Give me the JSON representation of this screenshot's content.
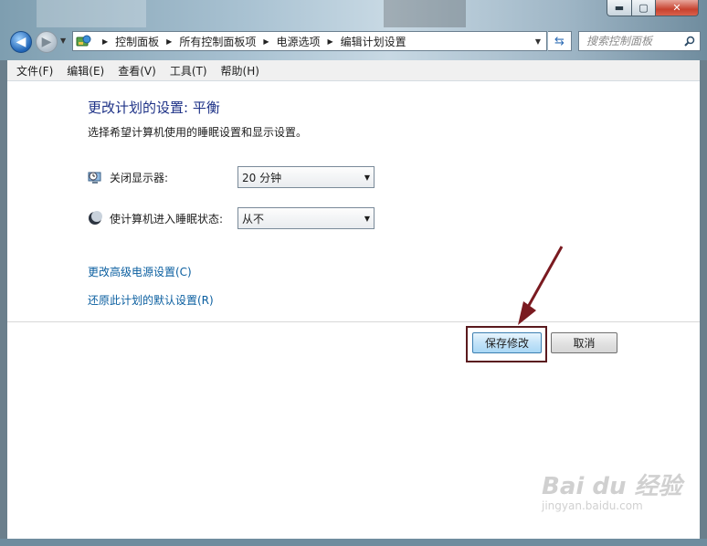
{
  "window": {
    "buttons": {
      "minimize": "▬",
      "maximize": "▢",
      "close": "✕"
    }
  },
  "nav": {
    "back_icon": "arrow-left-icon",
    "forward_icon": "arrow-right-icon",
    "breadcrumbs": [
      "控制面板",
      "所有控制面板项",
      "电源选项",
      "编辑计划设置"
    ],
    "search_placeholder": "搜索控制面板"
  },
  "menu": [
    "文件(F)",
    "编辑(E)",
    "查看(V)",
    "工具(T)",
    "帮助(H)"
  ],
  "page": {
    "title": "更改计划的设置: 平衡",
    "subtitle": "选择希望计算机使用的睡眠设置和显示设置。",
    "settings": [
      {
        "label": "关闭显示器:",
        "icon": "monitor-clock-icon",
        "value": "20 分钟"
      },
      {
        "label": "使计算机进入睡眠状态:",
        "icon": "moon-icon",
        "value": "从不"
      }
    ],
    "links": [
      "更改高级电源设置(C)",
      "还原此计划的默认设置(R)"
    ],
    "buttons": {
      "save": "保存修改",
      "cancel": "取消"
    }
  },
  "watermark": {
    "logo": "Bai du 经验",
    "url": "jingyan.baidu.com"
  },
  "colors": {
    "title": "#1e3287",
    "link": "#0b5fa0",
    "highlight": "#5a1a1e",
    "arrow": "#7a1a20"
  }
}
